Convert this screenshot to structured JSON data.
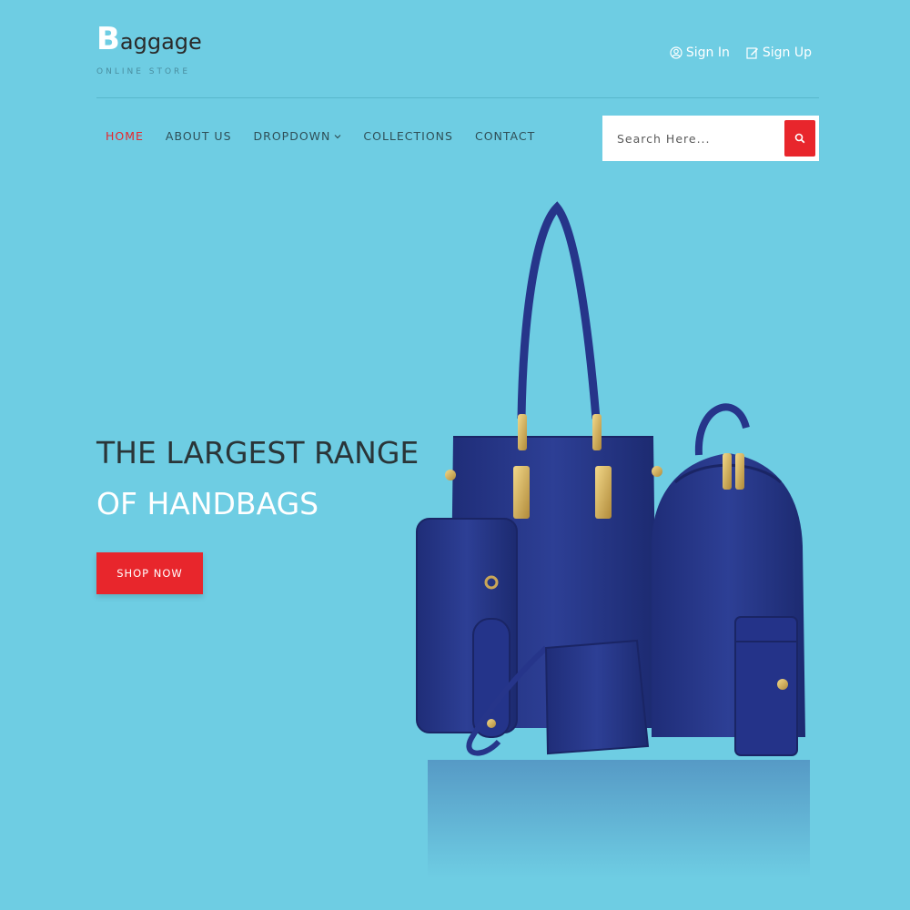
{
  "brand": {
    "initial": "B",
    "rest": "aggage",
    "tagline": "ONLINE STORE"
  },
  "account": {
    "signin_label": "Sign In",
    "signup_label": "Sign Up"
  },
  "nav": {
    "items": [
      {
        "label": "HOME",
        "active": true
      },
      {
        "label": "ABOUT US"
      },
      {
        "label": "DROPDOWN",
        "has_dropdown": true
      },
      {
        "label": "COLLECTIONS"
      },
      {
        "label": "CONTACT"
      }
    ]
  },
  "search": {
    "placeholder": "Search Here..."
  },
  "hero": {
    "title_line1": "THE LARGEST RANGE",
    "title_line2": "OF HANDBAGS",
    "cta_label": "SHOP NOW"
  },
  "icons": {
    "signin": "user-icon",
    "signup": "edit-icon",
    "dropdown": "chevron-down-icon",
    "search": "search-icon"
  },
  "colors": {
    "background": "#6ecde3",
    "accent": "#e8262c",
    "bag": "#2a3b8f",
    "text_dark": "#2a3538"
  }
}
